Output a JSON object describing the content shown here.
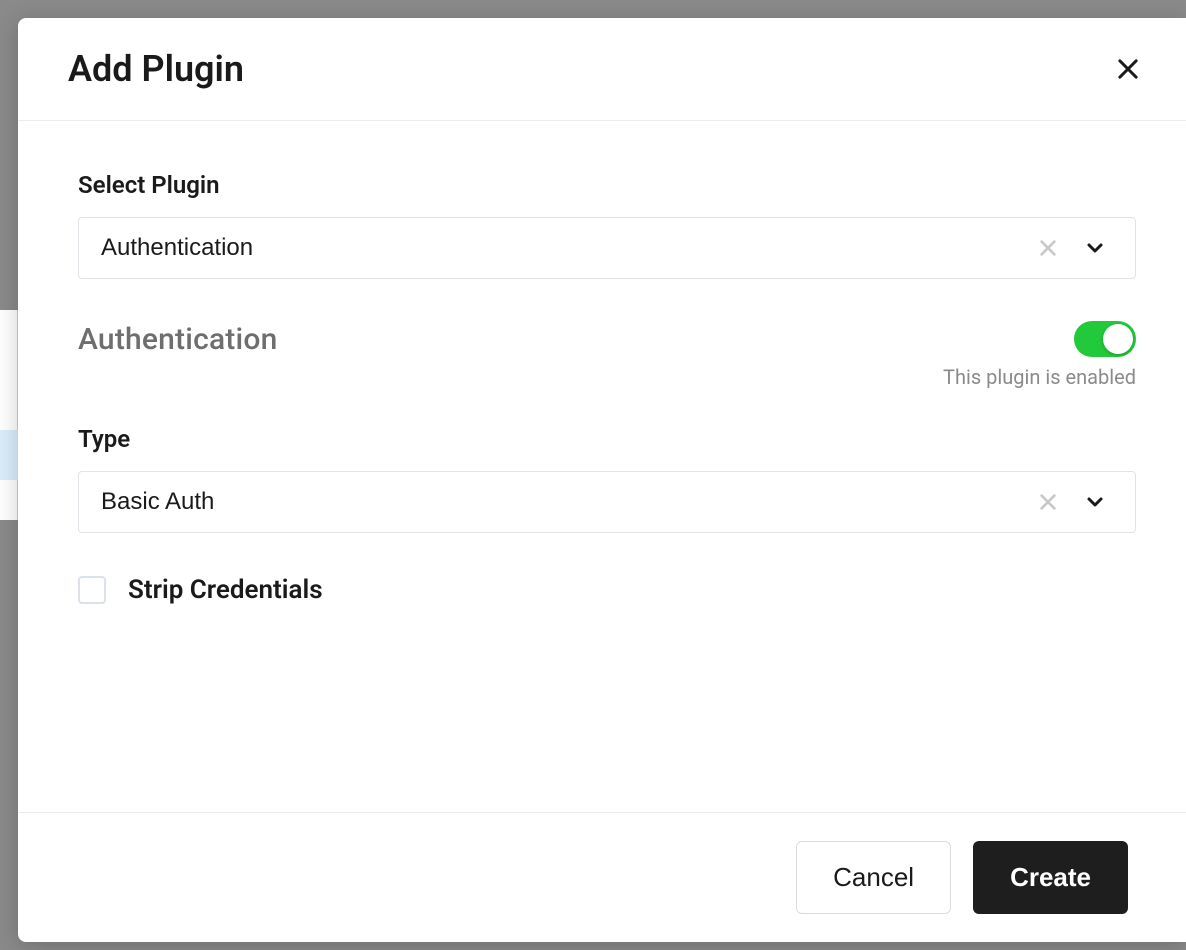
{
  "modal": {
    "title": "Add Plugin",
    "selectPlugin": {
      "label": "Select Plugin",
      "value": "Authentication"
    },
    "section": {
      "title": "Authentication",
      "enabledCaption": "This plugin is enabled"
    },
    "type": {
      "label": "Type",
      "value": "Basic Auth"
    },
    "stripCredentials": {
      "label": "Strip Credentials"
    },
    "footer": {
      "cancel": "Cancel",
      "create": "Create"
    }
  }
}
